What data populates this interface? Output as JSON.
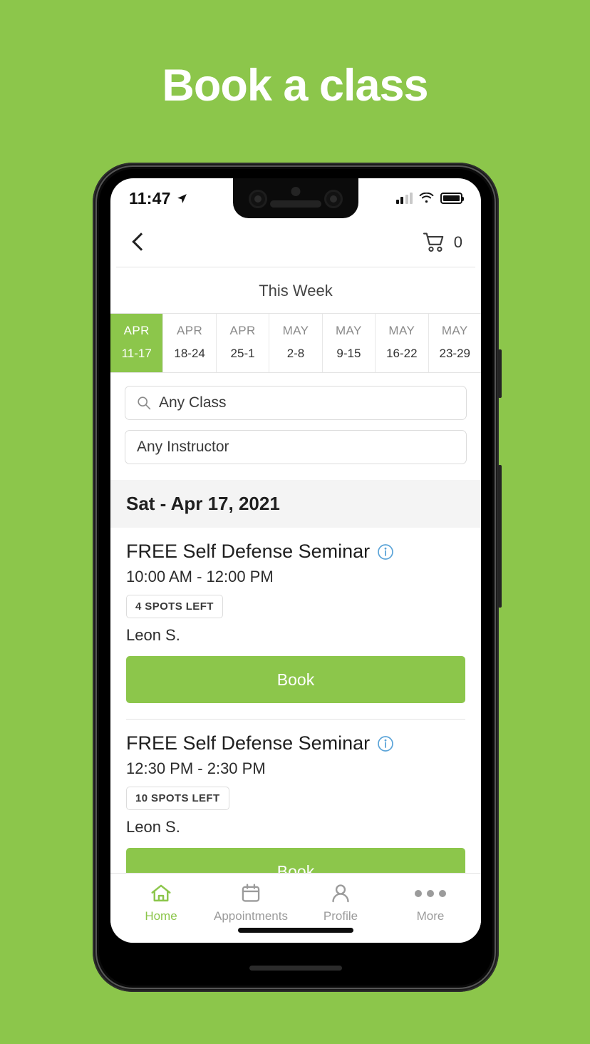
{
  "banner": {
    "title": "Book a class"
  },
  "status_bar": {
    "time": "11:47",
    "location_icon": "location-arrow-icon",
    "signal_icon": "cellular-signal-icon",
    "wifi_icon": "wifi-icon",
    "battery_icon": "battery-full-icon"
  },
  "appbar": {
    "back_icon": "back-chevron-icon",
    "cart_icon": "shopping-cart-icon",
    "cart_count": "0"
  },
  "week_header": {
    "label": "This Week"
  },
  "weeks": [
    {
      "month": "APR",
      "range": "11-17",
      "active": true
    },
    {
      "month": "APR",
      "range": "18-24",
      "active": false
    },
    {
      "month": "APR",
      "range": "25-1",
      "active": false
    },
    {
      "month": "MAY",
      "range": "2-8",
      "active": false
    },
    {
      "month": "MAY",
      "range": "9-15",
      "active": false
    },
    {
      "month": "MAY",
      "range": "16-22",
      "active": false
    },
    {
      "month": "MAY",
      "range": "23-29",
      "active": false
    }
  ],
  "filters": {
    "class_filter": "Any Class",
    "class_filter_icon": "search-icon",
    "instructor_filter": "Any Instructor"
  },
  "day": {
    "header": "Sat - Apr 17, 2021"
  },
  "classes": [
    {
      "title": "FREE Self Defense Seminar",
      "info_icon": "info-circle-icon",
      "time": "10:00 AM - 12:00 PM",
      "spots": "4 SPOTS LEFT",
      "instructor": "Leon S.",
      "book_label": "Book"
    },
    {
      "title": "FREE Self Defense Seminar",
      "info_icon": "info-circle-icon",
      "time": "12:30 PM - 2:30 PM",
      "spots": "10 SPOTS LEFT",
      "instructor": "Leon S.",
      "book_label": "Book"
    }
  ],
  "tabs": [
    {
      "label": "Home",
      "icon": "home-icon",
      "active": true
    },
    {
      "label": "Appointments",
      "icon": "calendar-icon",
      "active": false
    },
    {
      "label": "Profile",
      "icon": "person-icon",
      "active": false
    },
    {
      "label": "More",
      "icon": "ellipsis-icon",
      "active": false
    }
  ],
  "colors": {
    "brand_green": "#8CC64B",
    "info_blue": "#5BA4D8",
    "day_header_bg": "#F4F4F4"
  }
}
